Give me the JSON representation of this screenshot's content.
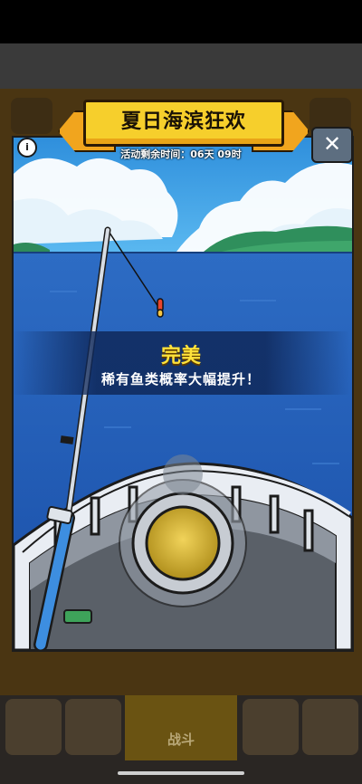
{
  "event": {
    "title": "夏日海滨狂欢",
    "timer": "活动剩余时间：06天 09时"
  },
  "result": {
    "grade": "完美",
    "message": "稀有鱼类概率大幅提升！"
  },
  "buttons": {
    "close": "✕",
    "info": "i"
  },
  "nav": {
    "battle_label": "战斗"
  },
  "colors": {
    "banner": "#f6cf2c",
    "sky": "#37a0e6",
    "sea": "#1f58b2",
    "highlight": "#ffe23a"
  }
}
